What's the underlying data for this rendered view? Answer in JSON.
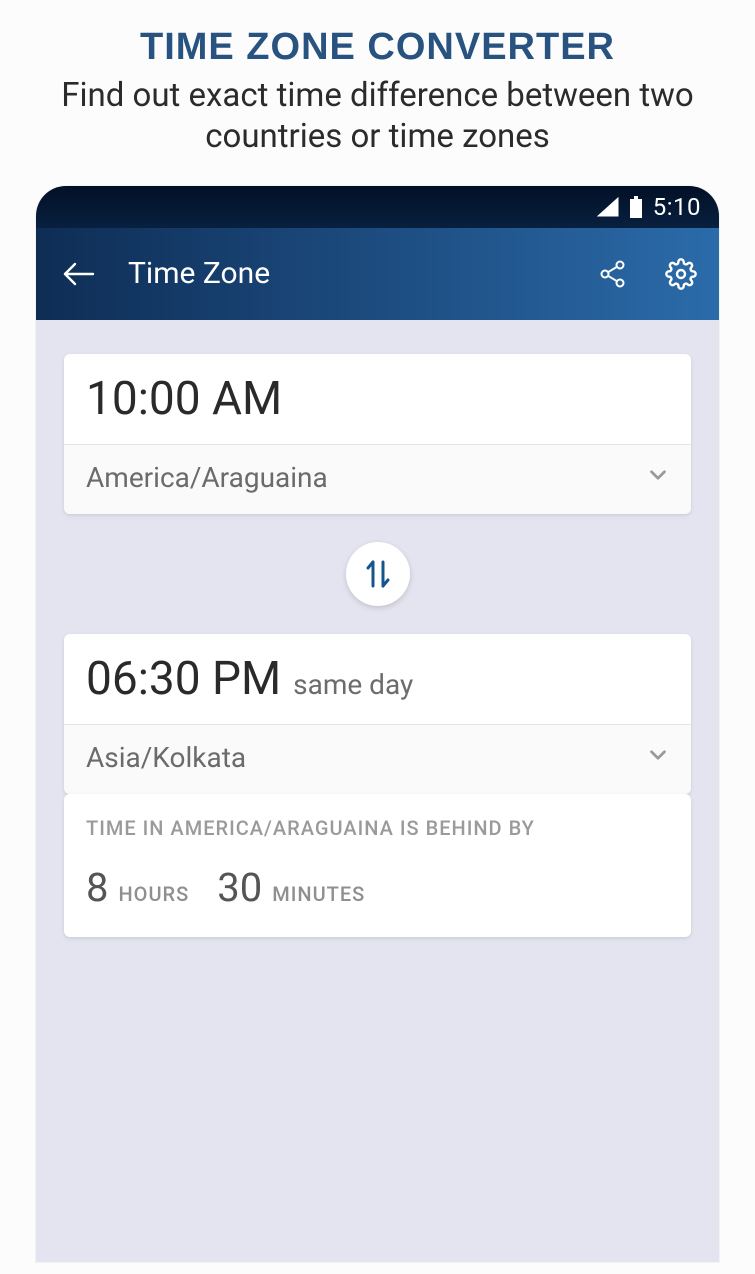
{
  "promo": {
    "title": "TIME ZONE CONVERTER",
    "subtitle": "Find out exact time difference between two countries or time zones"
  },
  "statusbar": {
    "time": "5:10"
  },
  "appbar": {
    "title": "Time Zone"
  },
  "from": {
    "time": "10:00 AM",
    "zone": "America/Araguaina"
  },
  "to": {
    "time": "06:30 PM",
    "note": "same day",
    "zone": "Asia/Kolkata"
  },
  "diff": {
    "header": "TIME IN AMERICA/ARAGUAINA IS BEHIND BY",
    "hours": "8",
    "hours_label": "HOURS",
    "minutes": "30",
    "minutes_label": "MINUTES"
  }
}
